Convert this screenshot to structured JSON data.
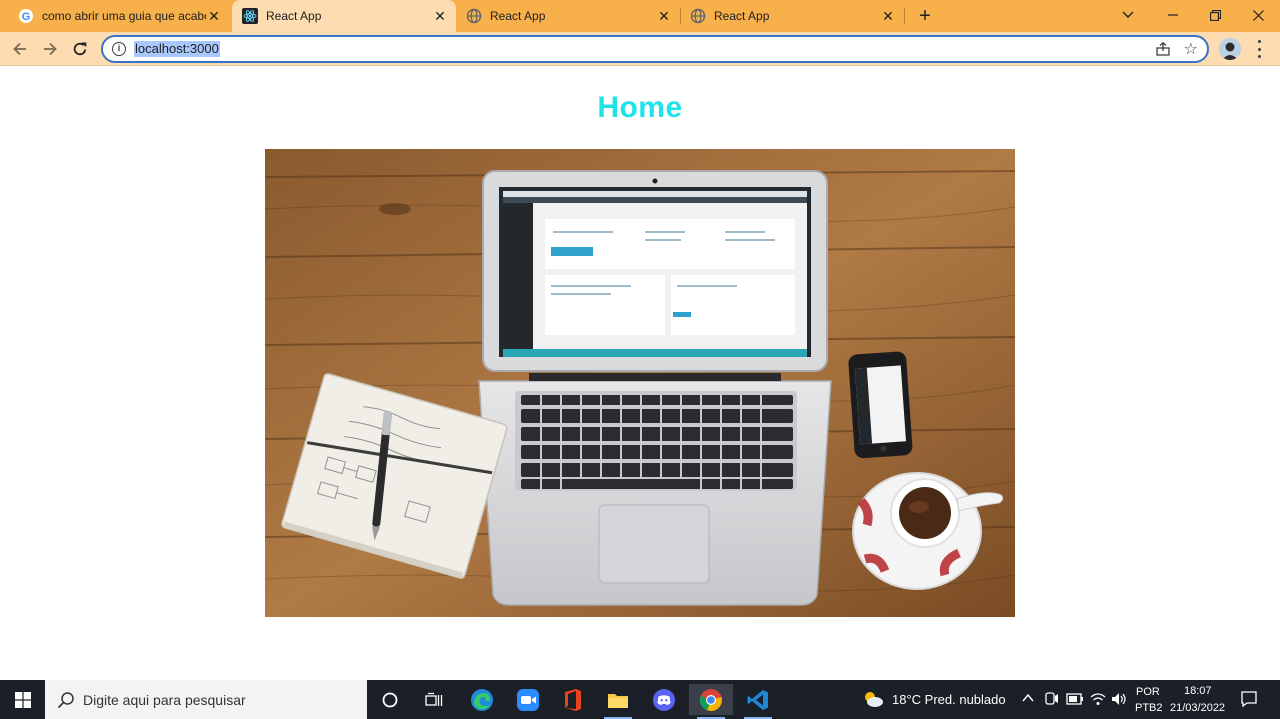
{
  "browser": {
    "tabs": [
      {
        "title": "como abrir uma guia que acabou",
        "icon": "google-icon",
        "active": false
      },
      {
        "title": "React App",
        "icon": "react-icon",
        "active": true
      },
      {
        "title": "React App",
        "icon": "globe-icon",
        "active": false
      },
      {
        "title": "React App",
        "icon": "globe-icon",
        "active": false
      }
    ],
    "url": "localhost:3000"
  },
  "page": {
    "title": "Home",
    "title_color": "#1ee3e9",
    "image_description": "laptop-on-wooden-desk-photo"
  },
  "taskbar": {
    "search_placeholder": "Digite aqui para pesquisar",
    "weather": "18°C  Pred. nublado",
    "language": "POR",
    "keyboard": "PTB2",
    "time": "18:07",
    "date": "21/03/2022"
  },
  "colors": {
    "tabstrip": "#f7b04a",
    "toolbar": "#fcdcb0",
    "taskbar": "#1b1f27",
    "accent": "#3a73c4"
  }
}
